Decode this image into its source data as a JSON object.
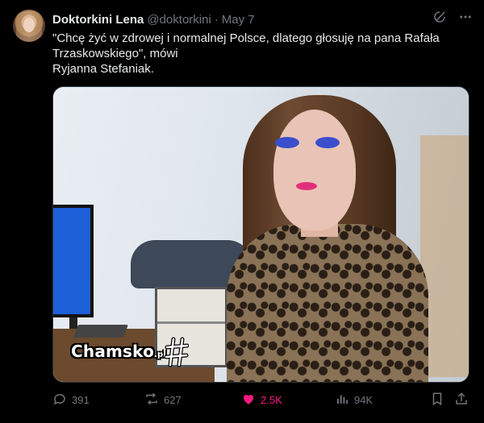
{
  "author": {
    "name": "Doktorkini Lena",
    "handle": "@doktorkini",
    "separator": "·",
    "date": "May 7"
  },
  "tweet": {
    "line1": "\"Chcę żyć w zdrowej i normalnej Polsce, dlatego głosuję na pana Rafała",
    "line2": "Trzaskowskiego\", mówi",
    "line3": "Ryjanna Stefaniak."
  },
  "media": {
    "watermark": "Chamsko",
    "watermark_suffix": ".pl"
  },
  "top_icons": [
    "grok-icon",
    "more-icon"
  ],
  "actions": {
    "replies": "391",
    "reposts": "627",
    "likes": "2.5K",
    "views": "94K"
  },
  "colors": {
    "background": "#000000",
    "muted": "#71767b",
    "text": "#e7e9ea",
    "like": "#f91880"
  }
}
